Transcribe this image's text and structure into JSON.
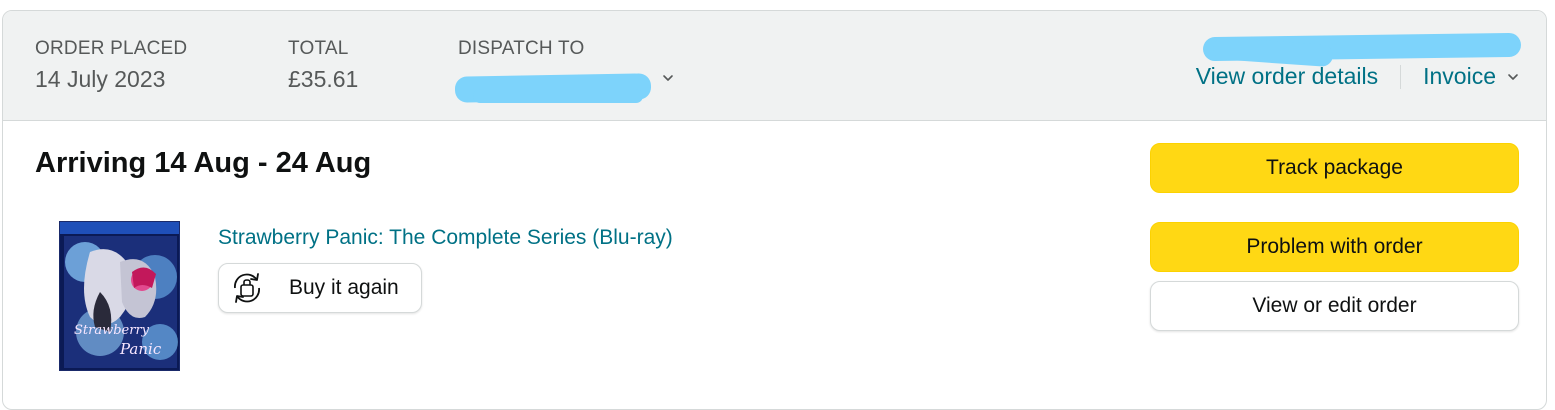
{
  "header": {
    "order_placed_label": "ORDER PLACED",
    "order_placed_value": "14 July 2023",
    "total_label": "TOTAL",
    "total_value": "£35.61",
    "dispatch_label": "DISPATCH TO",
    "view_order_details": "View order details",
    "invoice": "Invoice"
  },
  "shipment": {
    "arriving": "Arriving 14 Aug - 24 Aug"
  },
  "product": {
    "title": "Strawberry Panic: The Complete Series (Blu-ray)",
    "cover_text_line1": "Strawberry",
    "cover_text_line2": "Panic",
    "buy_again": "Buy it again"
  },
  "actions": {
    "track_package": "Track package",
    "problem_with_order": "Problem with order",
    "view_or_edit_order": "View or edit order"
  },
  "colors": {
    "link": "#007185",
    "button_yellow": "#ffd814",
    "header_bg": "#f0f2f2",
    "redaction": "#7dd3fb"
  },
  "icons": [
    "chevron-down-icon",
    "buy-again-icon"
  ]
}
